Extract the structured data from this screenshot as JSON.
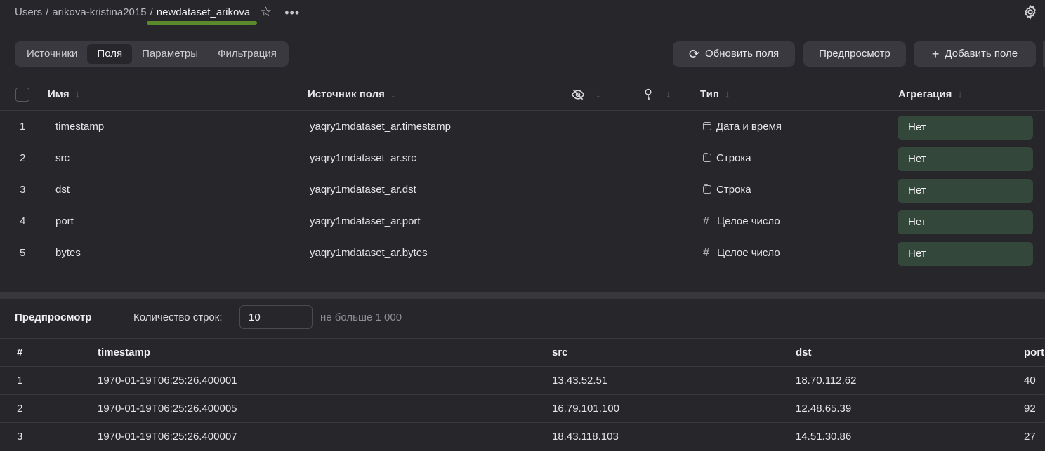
{
  "breadcrumb": {
    "root": "Users",
    "user": "arikova-kristina2015",
    "current": "newdataset_arikova",
    "separator": "/"
  },
  "tabs": [
    {
      "label": "Источники",
      "active": false
    },
    {
      "label": "Поля",
      "active": true
    },
    {
      "label": "Параметры",
      "active": false
    },
    {
      "label": "Фильтрация",
      "active": false
    }
  ],
  "toolbar": {
    "refresh_label": "Обновить поля",
    "preview_label": "Предпросмотр",
    "add_field_label": "Добавить поле"
  },
  "fields_table": {
    "headers": {
      "name": "Имя",
      "source": "Источник поля",
      "type": "Тип",
      "aggregation": "Агрегация"
    },
    "sort_arrow": "↓",
    "rows": [
      {
        "index": "1",
        "name": "timestamp",
        "source": "yaqry1mdataset_ar.timestamp",
        "type": "Дата и время",
        "type_icon": "calendar-icon",
        "aggregation": "Нет"
      },
      {
        "index": "2",
        "name": "src",
        "source": "yaqry1mdataset_ar.src",
        "type": "Строка",
        "type_icon": "string-icon",
        "aggregation": "Нет"
      },
      {
        "index": "3",
        "name": "dst",
        "source": "yaqry1mdataset_ar.dst",
        "type": "Строка",
        "type_icon": "string-icon",
        "aggregation": "Нет"
      },
      {
        "index": "4",
        "name": "port",
        "source": "yaqry1mdataset_ar.port",
        "type": "Целое число",
        "type_icon": "hash-icon",
        "aggregation": "Нет"
      },
      {
        "index": "5",
        "name": "bytes",
        "source": "yaqry1mdataset_ar.bytes",
        "type": "Целое число",
        "type_icon": "hash-icon",
        "aggregation": "Нет"
      }
    ]
  },
  "preview": {
    "title": "Предпросмотр",
    "rows_label": "Количество строк:",
    "rows_value": "10",
    "rows_hint": "не больше 1 000",
    "columns": [
      "#",
      "timestamp",
      "src",
      "dst",
      "port"
    ],
    "rows": [
      [
        "1",
        "1970-01-19T06:25:26.400001",
        "13.43.52.51",
        "18.70.112.62",
        "40"
      ],
      [
        "2",
        "1970-01-19T06:25:26.400005",
        "16.79.101.100",
        "12.48.65.39",
        "92"
      ],
      [
        "3",
        "1970-01-19T06:25:26.400007",
        "18.43.118.103",
        "14.51.30.86",
        "27"
      ]
    ]
  },
  "colors": {
    "background": "#27262b",
    "aggregation_chip": "#33483a",
    "underline_annotation": "#5b8a2c"
  }
}
